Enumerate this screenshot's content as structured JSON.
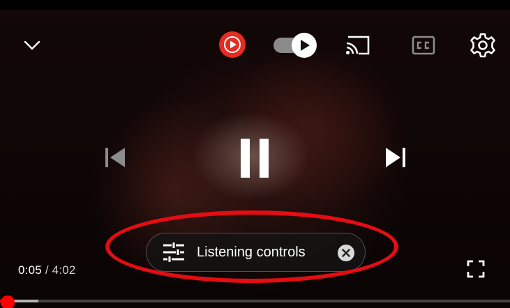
{
  "player": {
    "time_current": "0:05",
    "time_separator": " / ",
    "time_total": "4:02",
    "progress_played_fraction": 0.013,
    "progress_buffered_fraction": 0.075
  },
  "listening_chip": {
    "label": "Listening controls"
  },
  "icons": {
    "minimize": "chevron-down-icon",
    "music": "youtube-music-icon",
    "autoplay": "autoplay-toggle-icon",
    "cast": "cast-icon",
    "captions": "cc-icon",
    "settings": "gear-icon",
    "previous": "skip-previous-icon",
    "pause": "pause-icon",
    "next": "skip-next-icon",
    "listening": "sliders-icon",
    "close": "close-icon",
    "fullscreen": "fullscreen-icon"
  },
  "colors": {
    "accent": "#ff0000",
    "music_red": "#e32c22",
    "annotation": "#e40d12"
  }
}
